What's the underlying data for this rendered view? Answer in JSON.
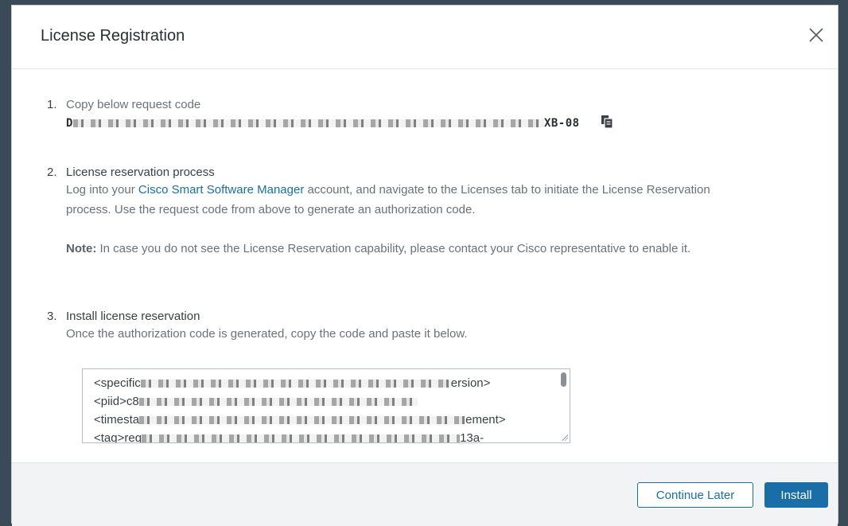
{
  "dialog": {
    "title": "License Registration"
  },
  "step1": {
    "number": "1.",
    "label": "Copy below request code",
    "code_start": "D",
    "code_end": "XB-08"
  },
  "step2": {
    "number": "2.",
    "label": "License reservation process",
    "text_before_link": "Log into your ",
    "link": "Cisco Smart Software Manager",
    "text_after_link": " account, and navigate to the Licenses tab to initiate the License Reservation process. Use the request code from above to generate an authorization code.",
    "note_label": "Note:",
    "note_text": " In case you do not see the License Reservation capability, please contact your Cisco representative to enable it."
  },
  "step3": {
    "number": "3.",
    "label": "Install license reservation",
    "text": "Once the authorization code is generated, copy the code and paste it below."
  },
  "textarea": {
    "lines": [
      {
        "start": "<specific",
        "end": "ersion>"
      },
      {
        "start": "<piid>c8",
        "end": ""
      },
      {
        "start": "<timesta",
        "end": "ement>"
      },
      {
        "start": "<tag>reg",
        "end": "13a-"
      }
    ]
  },
  "footer": {
    "continue_label": "Continue Later",
    "install_label": "Install"
  },
  "colors": {
    "accent": "#1a6ea8",
    "backdrop": "#3b4a57"
  }
}
